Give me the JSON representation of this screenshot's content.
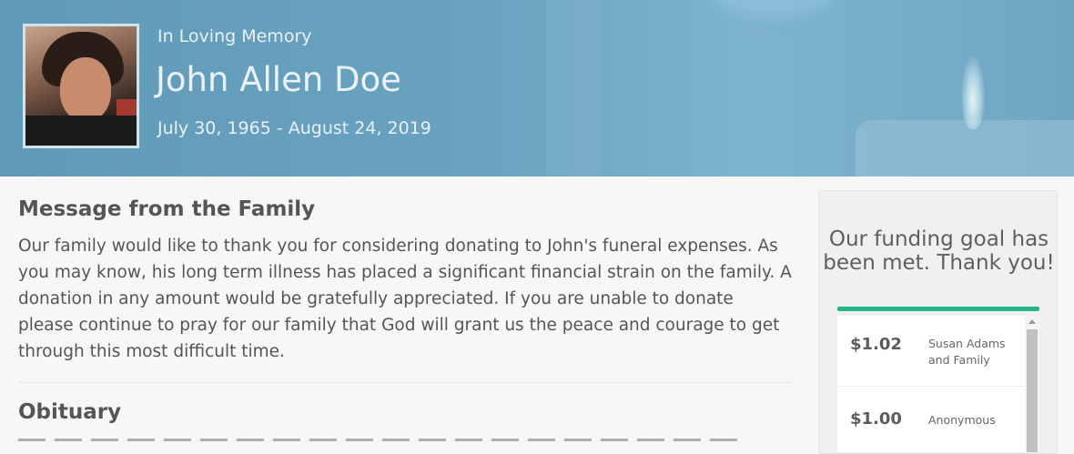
{
  "header": {
    "subtitle": "In Loving Memory",
    "name": "John Allen Doe",
    "dates": "July 30, 1965 - August 24, 2019"
  },
  "main": {
    "message_title": "Message from the Family",
    "message_body": "Our family would like to thank you for considering donating to John's funeral expenses. As you may know, his long term illness has placed a significant financial strain on the family. A donation in any amount would be gratefully appreciated. If you are unable to donate please continue to pray for our family that God will grant us the peace and courage to get through this most difficult time.",
    "obituary_title": "Obituary"
  },
  "sidebar": {
    "goal_message": "Our funding goal has been met. Thank you!",
    "donations": [
      {
        "amount": "$1.02",
        "donor": "Susan Adams and Family"
      },
      {
        "amount": "$1.00",
        "donor": "Anonymous"
      }
    ]
  },
  "colors": {
    "banner": "#6aa3c0",
    "goal_bar": "#27b18b",
    "text": "#555555"
  }
}
